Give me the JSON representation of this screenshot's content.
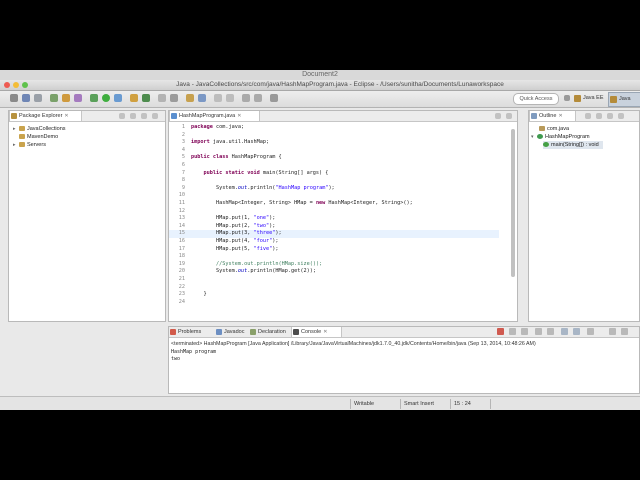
{
  "document_title": "Document2",
  "window": {
    "title": "Java - JavaCollections/src/com/java/HashMapProgram.java - Eclipse - /Users/sunitha/Documents/Lunaworkspace"
  },
  "toolbar": {
    "quick_access_placeholder": "Quick Access",
    "perspectives": [
      {
        "label": "Java EE"
      },
      {
        "label": "Java"
      }
    ]
  },
  "package_explorer": {
    "tab_label": "Package Explorer",
    "items": [
      {
        "label": "JavaCollections",
        "expanded": true
      },
      {
        "label": "MavenDemo",
        "expanded": false
      },
      {
        "label": "Servers",
        "expanded": true
      }
    ]
  },
  "editor": {
    "tab_label": "HashMapProgram.java",
    "current_line": 15,
    "lines": [
      {
        "n": "1",
        "html": "<span class=\"kw\">package</span> com.java;"
      },
      {
        "n": "2",
        "html": ""
      },
      {
        "n": "3",
        "html": "<span class=\"kw\">import</span> java.util.HashMap;"
      },
      {
        "n": "4",
        "html": ""
      },
      {
        "n": "5",
        "html": "<span class=\"kw\">public class</span> HashMapProgram {"
      },
      {
        "n": "6",
        "html": ""
      },
      {
        "n": "7",
        "html": "    <span class=\"kw\">public static void</span> main(String[] args) {"
      },
      {
        "n": "8",
        "html": ""
      },
      {
        "n": "9",
        "html": "        System.<span class=\"fld\">out</span>.println(<span class=\"str\">\"HashMap program\"</span>);"
      },
      {
        "n": "10",
        "html": ""
      },
      {
        "n": "11",
        "html": "        HashMap&lt;Integer, String&gt; HMap = <span class=\"kw\">new</span> HashMap&lt;Integer, String&gt;();"
      },
      {
        "n": "12",
        "html": ""
      },
      {
        "n": "13",
        "html": "        HMap.put(1, <span class=\"str\">\"one\"</span>);"
      },
      {
        "n": "14",
        "html": "        HMap.put(2, <span class=\"str\">\"two\"</span>);"
      },
      {
        "n": "15",
        "html": "        HMap.put(3, <span class=\"str\">\"three\"</span>);"
      },
      {
        "n": "16",
        "html": "        HMap.put(4, <span class=\"str\">\"four\"</span>);"
      },
      {
        "n": "17",
        "html": "        HMap.put(5, <span class=\"str\">\"five\"</span>);"
      },
      {
        "n": "18",
        "html": ""
      },
      {
        "n": "19",
        "html": "        <span class=\"cm\">//System.out.println(HMap.size());</span>"
      },
      {
        "n": "20",
        "html": "        System.<span class=\"fld\">out</span>.println(HMap.get(2));"
      },
      {
        "n": "21",
        "html": ""
      },
      {
        "n": "22",
        "html": ""
      },
      {
        "n": "23",
        "html": "    }"
      },
      {
        "n": "24",
        "html": ""
      }
    ]
  },
  "outline": {
    "tab_label": "Outline",
    "items": [
      {
        "label": "com.java"
      },
      {
        "label": "HashMapProgram"
      },
      {
        "label": "main(String[]) : void"
      }
    ]
  },
  "bottom_panel": {
    "tabs": [
      {
        "label": "Problems"
      },
      {
        "label": "Javadoc"
      },
      {
        "label": "Declaration"
      },
      {
        "label": "Console",
        "active": true
      }
    ],
    "console_header": "<terminated> HashMapProgram [Java Application] /Library/Java/JavaVirtualMachines/jdk1.7.0_40.jdk/Contents/Home/bin/java (Sep 13, 2014, 10:48:26 AM)",
    "console_output": [
      "HashMap program",
      "two"
    ]
  },
  "statusbar": {
    "writable": "Writable",
    "insert_mode": "Smart Insert",
    "position": "15 : 24"
  }
}
